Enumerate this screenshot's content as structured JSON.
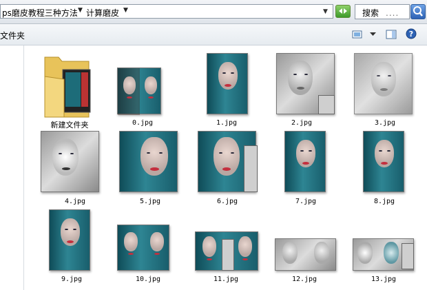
{
  "address_bar": {
    "crumbs": [
      "ps磨皮教程三种方法",
      "计算磨皮"
    ],
    "search_placeholder": "搜索",
    "search_dots": "...."
  },
  "toolbar": {
    "menu_label": "文件夹"
  },
  "files": [
    {
      "name": "新建文件夹",
      "kind": "folder"
    },
    {
      "name": "0.jpg",
      "kind": "teal"
    },
    {
      "name": "1.jpg",
      "kind": "teal"
    },
    {
      "name": "2.jpg",
      "kind": "gray"
    },
    {
      "name": "3.jpg",
      "kind": "gray"
    },
    {
      "name": "4.jpg",
      "kind": "gray"
    },
    {
      "name": "5.jpg",
      "kind": "teal"
    },
    {
      "name": "6.jpg",
      "kind": "teal"
    },
    {
      "name": "7.jpg",
      "kind": "teal"
    },
    {
      "name": "8.jpg",
      "kind": "teal"
    },
    {
      "name": "9.jpg",
      "kind": "teal"
    },
    {
      "name": "10.jpg",
      "kind": "teal"
    },
    {
      "name": "11.jpg",
      "kind": "teal"
    },
    {
      "name": "12.jpg",
      "kind": "gray"
    },
    {
      "name": "13.jpg",
      "kind": "gray"
    }
  ],
  "colors": {
    "accent": "#2d62b5",
    "refresh": "#3d9a2a"
  }
}
